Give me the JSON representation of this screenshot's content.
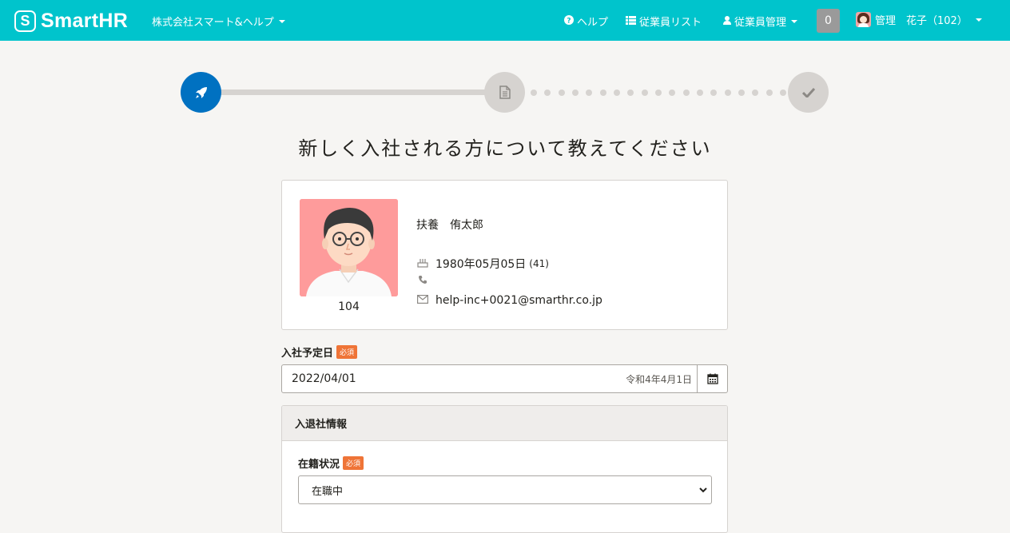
{
  "header": {
    "logo_mark": "S",
    "logo_text": "SmartHR",
    "company": "株式会社スマート&ヘルプ",
    "nav_help": "ヘルプ",
    "nav_employee_list": "従業員リスト",
    "nav_employee_manage": "従業員管理",
    "notification_count": "0",
    "user_name": "管理　花子（102）"
  },
  "steps": {
    "current": 1,
    "total": 3,
    "icons": [
      "rocket-icon",
      "document-icon",
      "check-icon"
    ]
  },
  "page_title": "新しく入社される方について教えてください",
  "employee": {
    "number": "104",
    "name": "扶養　侑太郎",
    "birthday": "1980年05月05日",
    "age": "(41)",
    "phone": "",
    "email": "help-inc+0021@smarthr.co.jp"
  },
  "join_date": {
    "label": "入社予定日",
    "required": "必須",
    "value": "2022/04/01",
    "wareki": "令和4年4月1日"
  },
  "employment_panel": {
    "title": "入退社情報",
    "status_label": "在籍状況",
    "required": "必須",
    "status_value": "在職中"
  },
  "colors": {
    "brand": "#00c4cc",
    "step_active": "#0071c1",
    "required_badge": "#ef7437"
  }
}
